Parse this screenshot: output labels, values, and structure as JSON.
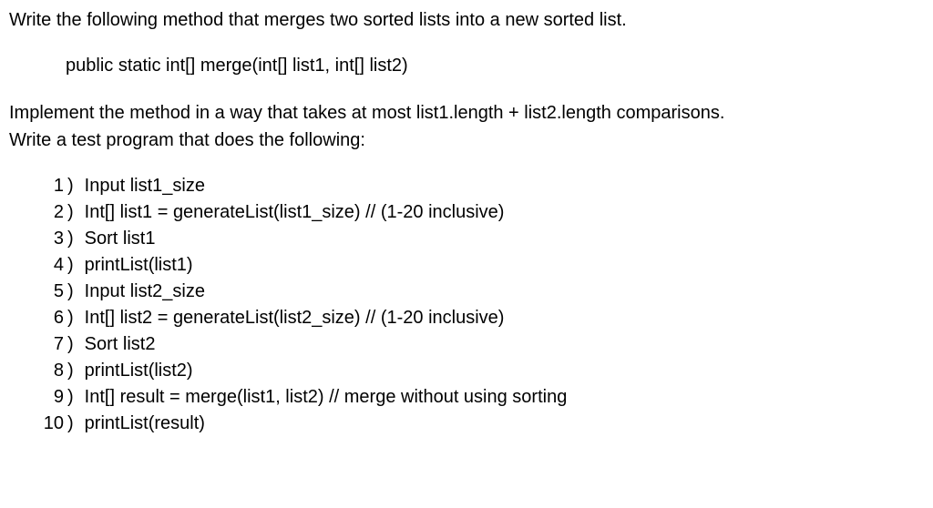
{
  "intro": "Write the following method that merges two sorted lists into a new sorted list.",
  "signature": "public static int[] merge(int[] list1, int[] list2)",
  "implement": "Implement the method in a way that takes at most list1.length + list2.length comparisons.",
  "testIntro": "Write a test program that does the following:",
  "steps": [
    {
      "num": "1",
      "text": "Input list1_size"
    },
    {
      "num": "2",
      "text": "Int[] list1 = generateList(list1_size) // (1-20 inclusive)"
    },
    {
      "num": "3",
      "text": "Sort list1"
    },
    {
      "num": "4",
      "text": "printList(list1)"
    },
    {
      "num": "5",
      "text": "Input list2_size"
    },
    {
      "num": "6",
      "text": "Int[] list2 = generateList(list2_size) // (1-20 inclusive)"
    },
    {
      "num": "7",
      "text": "Sort list2"
    },
    {
      "num": "8",
      "text": "printList(list2)"
    },
    {
      "num": "9",
      "text": "Int[] result = merge(list1, list2) // merge without using sorting"
    },
    {
      "num": "10",
      "text": "printList(result)"
    }
  ]
}
